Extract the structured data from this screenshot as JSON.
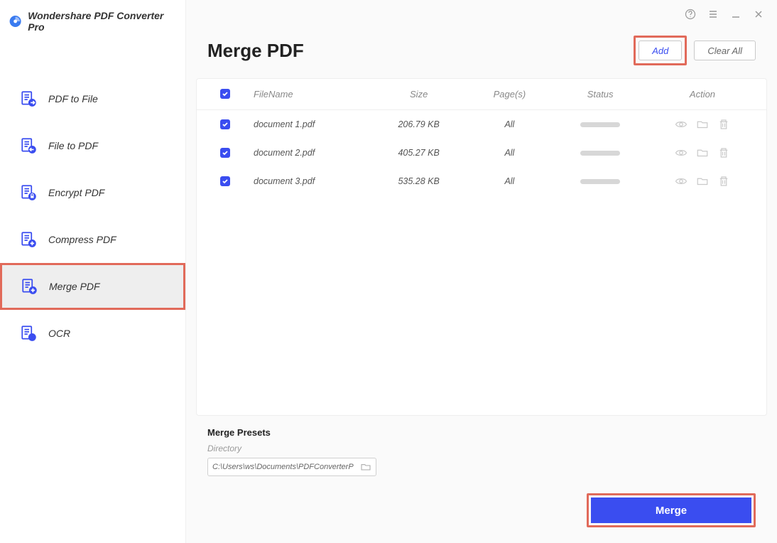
{
  "app_title": "Wondershare PDF Converter Pro",
  "sidebar": {
    "items": [
      {
        "label": "PDF to File",
        "active": false,
        "icon": "arrow-right"
      },
      {
        "label": "File to PDF",
        "active": false,
        "icon": "arrow-left"
      },
      {
        "label": "Encrypt PDF",
        "active": false,
        "icon": "lock"
      },
      {
        "label": "Compress PDF",
        "active": false,
        "icon": "plus"
      },
      {
        "label": "Merge PDF",
        "active": true,
        "icon": "plus"
      },
      {
        "label": "OCR",
        "active": false,
        "icon": "a"
      }
    ]
  },
  "header": {
    "title": "Merge PDF",
    "add_label": "Add",
    "clear_label": "Clear All"
  },
  "table": {
    "columns": {
      "filename": "FileName",
      "size": "Size",
      "pages": "Page(s)",
      "status": "Status",
      "action": "Action"
    },
    "rows": [
      {
        "checked": true,
        "filename": "document 1.pdf",
        "size": "206.79 KB",
        "pages": "All"
      },
      {
        "checked": true,
        "filename": "document 2.pdf",
        "size": "405.27 KB",
        "pages": "All"
      },
      {
        "checked": true,
        "filename": "document 3.pdf",
        "size": "535.28 KB",
        "pages": "All"
      }
    ]
  },
  "presets": {
    "title": "Merge Presets",
    "directory_label": "Directory",
    "directory_value": "C:\\Users\\ws\\Documents\\PDFConverterP"
  },
  "footer": {
    "merge_label": "Merge"
  }
}
